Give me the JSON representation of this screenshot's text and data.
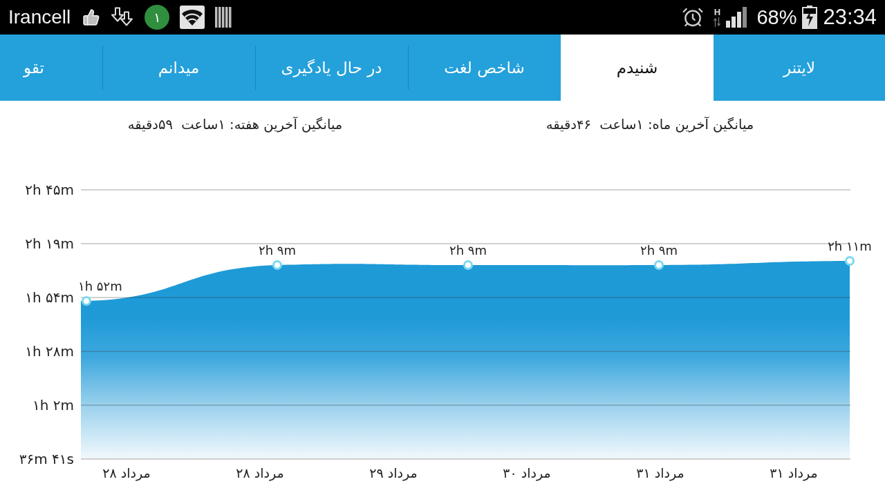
{
  "status_bar": {
    "carrier": "Irancell",
    "notification_count": "۱",
    "network_type": "H",
    "battery": "68%",
    "time": "23:34"
  },
  "tabs": [
    {
      "label": "لایتنر",
      "selected": false
    },
    {
      "label": "شنیدم",
      "selected": true
    },
    {
      "label": "شاخص لغت",
      "selected": false
    },
    {
      "label": "در حال یادگیری",
      "selected": false
    },
    {
      "label": "میدانم",
      "selected": false
    },
    {
      "label": "تقو",
      "selected": false
    }
  ],
  "averages": [
    "میانگین آخرین ماه: ۱ساعت  ۴۶دقیقه",
    "میانگین آخرین هفته: ۱ساعت  ۵۹دقیقه"
  ],
  "chart": {
    "y_axis_labels": [
      "۲h ۴۵m",
      "۲h ۱۹m",
      "۱h ۵۴m",
      "۱h ۲۸m",
      "۱h ۲m",
      "۳۶m ۴۱s"
    ],
    "point_labels": [
      "۲h ۱۱m",
      "۲h ۹m",
      "۲h ۹m",
      "۲h ۹m",
      "۱h ۵۲m"
    ],
    "x_axis_labels": [
      "۳۱ مرداد",
      "۳۱ مرداد",
      "۳۰ مرداد",
      "۲۹ مرداد",
      "۲۸ مرداد",
      "۲۸ مرداد"
    ]
  }
}
